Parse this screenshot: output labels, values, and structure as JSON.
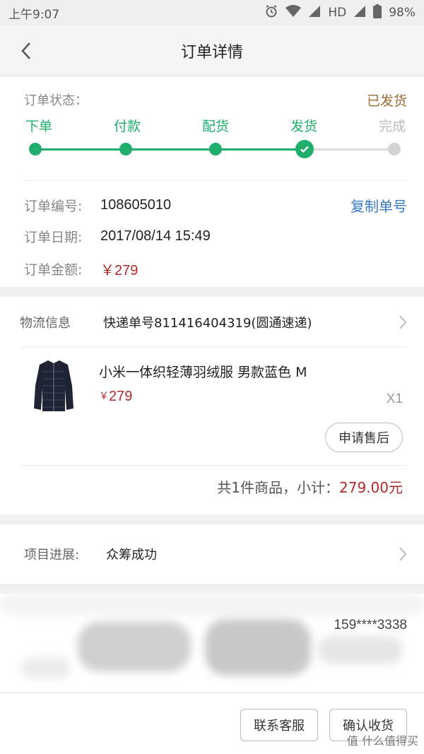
{
  "status_bar": {
    "time": "上午9:07",
    "network": "HD",
    "battery": "98%"
  },
  "nav": {
    "title": "订单详情"
  },
  "order": {
    "status_label": "订单状态：",
    "status_value": "已发货",
    "steps": [
      {
        "label": "下单",
        "state": "done"
      },
      {
        "label": "付款",
        "state": "done"
      },
      {
        "label": "配货",
        "state": "done"
      },
      {
        "label": "发货",
        "state": "current"
      },
      {
        "label": "完成",
        "state": "pending"
      }
    ],
    "number_label": "订单编号:",
    "number_value": "108605010",
    "copy_label": "复制单号",
    "date_label": "订单日期:",
    "date_value": "2017/08/14 15:49",
    "amount_label": "订单金额:",
    "amount_value": "￥279"
  },
  "logistics": {
    "label": "物流信息",
    "value": "快递单号811416404319(圆通速递)"
  },
  "product": {
    "name": "小米一体织轻薄羽绒服 男款蓝色 M",
    "currency": "￥",
    "price": "279",
    "qty": "X1",
    "aftersale_label": "申请售后",
    "image_icon": "down-jacket-image"
  },
  "subtotal": {
    "prefix": "共1件商品，小计：",
    "amount": "279.00元"
  },
  "project": {
    "label": "项目进展:",
    "value": "众筹成功"
  },
  "address": {
    "phone": "159****3338"
  },
  "actions": {
    "contact_label": "联系客服",
    "confirm_label": "确认收货"
  },
  "watermark": {
    "text": "值 什么值得买"
  },
  "colors": {
    "progress_green": "#1fae6b",
    "status_brown": "#9b6a33",
    "price_red": "#b02a2a",
    "link_blue": "#3a79c9"
  }
}
